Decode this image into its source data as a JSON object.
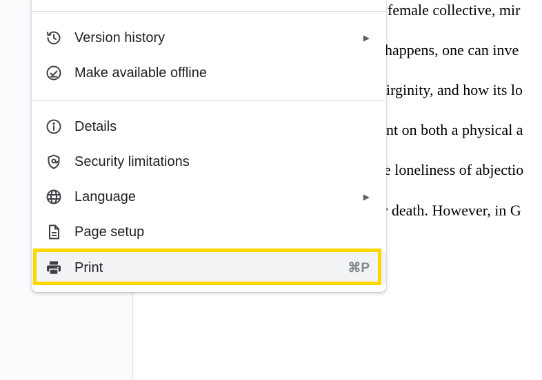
{
  "document": {
    "lines": [
      "female collective, mir",
      "happens, one can inve",
      "irginity, and how its lo",
      "nt on both a physical a",
      "e loneliness of abjectio",
      "r death. However, in G"
    ]
  },
  "menu": {
    "items": [
      {
        "label": "Version history",
        "icon": "history-icon",
        "submenu": true
      },
      {
        "label": "Make available offline",
        "icon": "offline-check-icon",
        "submenu": false
      },
      {
        "label": "Details",
        "icon": "info-icon",
        "submenu": false
      },
      {
        "label": "Security limitations",
        "icon": "shield-icon",
        "submenu": false
      },
      {
        "label": "Language",
        "icon": "globe-icon",
        "submenu": true
      },
      {
        "label": "Page setup",
        "icon": "document-icon",
        "submenu": false
      },
      {
        "label": "Print",
        "icon": "print-icon",
        "shortcut": "⌘P",
        "highlighted": true
      }
    ],
    "submenu_arrow": "▶"
  },
  "colors": {
    "highlight_border": "#ffd700",
    "highlight_bg": "#f1f3f4"
  }
}
